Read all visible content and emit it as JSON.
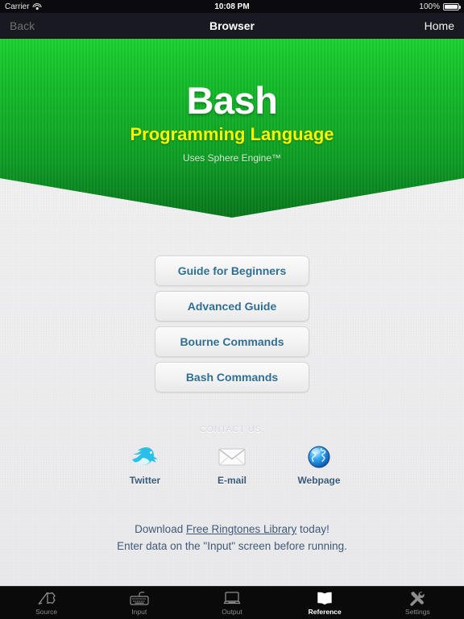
{
  "status_bar": {
    "carrier": "Carrier",
    "wifi_icon": "wifi-icon",
    "time": "10:08 PM",
    "battery_percent": "100%",
    "battery_icon": "battery-full-icon"
  },
  "nav_bar": {
    "back_label": "Back",
    "title": "Browser",
    "home_label": "Home"
  },
  "hero": {
    "title": "Bash",
    "subtitle": "Programming Language",
    "tagline": "Uses Sphere Engine™",
    "bg_color_top": "#1ad02f",
    "bg_color_bottom": "#08821e",
    "title_color": "#ffffff",
    "subtitle_color": "#fcf500"
  },
  "menu": {
    "buttons": [
      {
        "label": "Guide for Beginners"
      },
      {
        "label": "Advanced Guide"
      },
      {
        "label": "Bourne Commands"
      },
      {
        "label": "Bash Commands"
      }
    ],
    "text_color": "#2e6e93"
  },
  "contact": {
    "heading": "CONTACT US:",
    "items": [
      {
        "label": "Twitter",
        "icon": "twitter-bird-icon"
      },
      {
        "label": "E-mail",
        "icon": "envelope-icon"
      },
      {
        "label": "Webpage",
        "icon": "globe-icon"
      }
    ]
  },
  "footer": {
    "line1_prefix": "Download ",
    "line1_link": "Free Ringtones Library",
    "line1_suffix": " today!",
    "line2": "Enter data on the \"Input\" screen before running."
  },
  "tab_bar": {
    "items": [
      {
        "label": "Source",
        "icon": "pen-writing-icon",
        "active": false
      },
      {
        "label": "Input",
        "icon": "keyboard-icon",
        "active": false
      },
      {
        "label": "Output",
        "icon": "monitor-icon",
        "active": false
      },
      {
        "label": "Reference",
        "icon": "open-book-icon",
        "active": true
      },
      {
        "label": "Settings",
        "icon": "tools-icon",
        "active": false
      }
    ],
    "active_color": "#ffffff",
    "inactive_color": "#8d8d8f"
  }
}
